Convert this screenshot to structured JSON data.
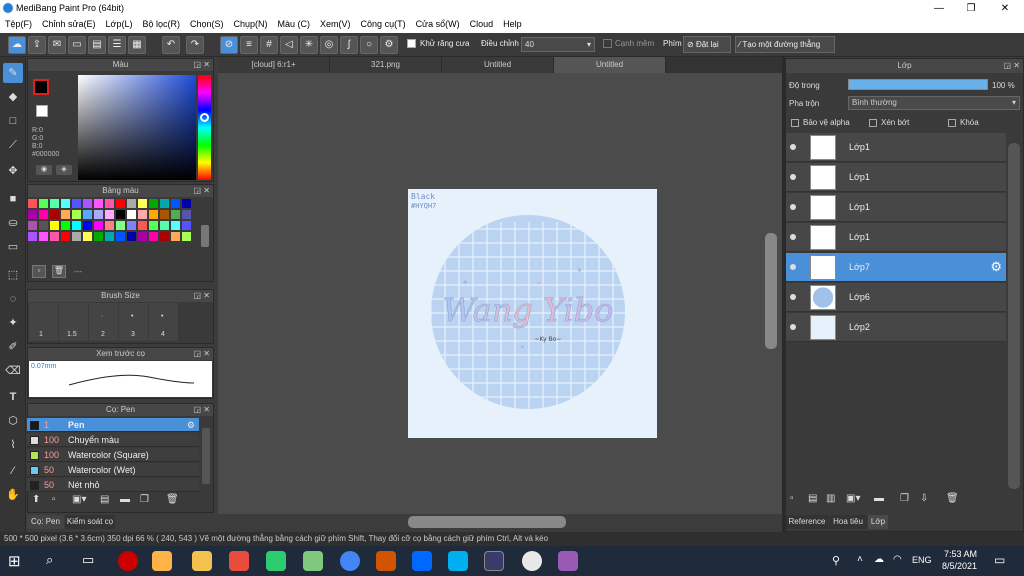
{
  "app": {
    "title": "MediBang Paint Pro (64bit)"
  },
  "menu": [
    "Tệp(F)",
    "Chỉnh sửa(E)",
    "Lớp(L)",
    "Bộ lọc(R)",
    "Chọn(S)",
    "Chụp(N)",
    "Màu (C)",
    "Xem(V)",
    "Công cụ(T)",
    "Cửa sổ(W)",
    "Cloud",
    "Help"
  ],
  "toolbar": {
    "antialias_label": "Khử răng cưa",
    "adjust_label": "Điều chỉnh",
    "adjust_value": "40",
    "edge_label": "Cạnh mềm",
    "key_label": "Phím",
    "reset_label": "Đặt lại",
    "line_label": "Tạo một đường thẳng"
  },
  "tabs": [
    "[cloud] 6:r1+",
    "321.png",
    "Untitled",
    "Untitled"
  ],
  "color_panel": {
    "title": "Màu",
    "r": "R:0",
    "g": "G:0",
    "b": "B:0",
    "hex": "#000000"
  },
  "palette_panel": {
    "title": "Bảng màu",
    "footer": "---"
  },
  "brushsize_panel": {
    "title": "Brush Size",
    "sizes": [
      "1",
      "1.5",
      "2",
      "3",
      "4"
    ]
  },
  "preview_panel": {
    "title": "Xem trước cọ",
    "size": "0.07mm"
  },
  "brush_panel": {
    "title": "Cọ: Pen",
    "items": [
      {
        "size": "1",
        "name": "Pen",
        "color": "#1a1a1a"
      },
      {
        "size": "100",
        "name": "Chuyển màu",
        "color": "#dddddd"
      },
      {
        "size": "100",
        "name": "Watercolor (Square)",
        "color": "#b8e05a"
      },
      {
        "size": "50",
        "name": "Watercolor (Wet)",
        "color": "#6ec9f0"
      },
      {
        "size": "50",
        "name": "Nét nhỏ",
        "color": "#222222"
      }
    ]
  },
  "left_bottom_tabs": [
    "Cọ: Pen",
    "Kiểm soát cọ"
  ],
  "artwork": {
    "text": "Wang Yibo",
    "tag": "Black\n#HYQH7",
    "sub": "~Ky Bo~"
  },
  "layer_panel": {
    "title": "Lớp",
    "opacity_label": "Độ trong",
    "opacity_value": "100 %",
    "blend_label": "Pha trộn",
    "blend_value": "Bình thường",
    "alpha_label": "Bảo vệ alpha",
    "clip_label": "Xén bớt",
    "lock_label": "Khóa",
    "layers": [
      "Lớp1",
      "Lớp1",
      "Lớp1",
      "Lớp1",
      "Lớp7",
      "Lớp6",
      "Lớp2"
    ],
    "bottom_tabs": [
      "Reference",
      "Hoa tiêu",
      "Lớp"
    ]
  },
  "status": {
    "text": "500 * 500 pixel  (3.6 * 3.6cm)  350 dpi  66 %  ( 240, 543 )  Vẽ một đường thẳng bằng cách giữ phím Shift, Thay đổi cỡ cọ bằng cách giữ phím Ctrl, Alt và kéo"
  },
  "taskbar": {
    "lang": "ENG",
    "time": "7:53 AM",
    "date": "8/5/2021"
  }
}
